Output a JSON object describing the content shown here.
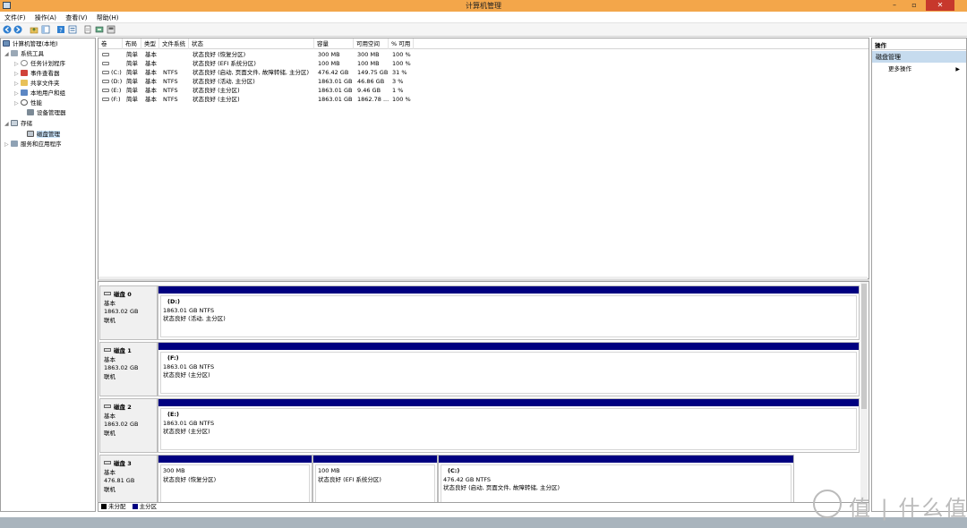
{
  "window": {
    "title": "计算机管理",
    "minimize": "–",
    "maximize": "▫",
    "close": "✕"
  },
  "menu": {
    "items": [
      "文件(F)",
      "操作(A)",
      "查看(V)",
      "帮助(H)"
    ]
  },
  "toolbar": {
    "icons": [
      "back-icon",
      "forward-icon",
      "folder-up-icon",
      "show-tree-icon",
      "help-icon",
      "properties-icon",
      "export-icon",
      "settings-icon"
    ]
  },
  "tree": {
    "items": [
      {
        "label": "计算机管理(本地)",
        "arrow": ""
      },
      {
        "label": "系统工具",
        "arrow": "◢"
      },
      {
        "label": "任务计划程序",
        "arrow": "▷"
      },
      {
        "label": "事件查看器",
        "arrow": "▷"
      },
      {
        "label": "共享文件夹",
        "arrow": "▷"
      },
      {
        "label": "本地用户和组",
        "arrow": "▷"
      },
      {
        "label": "性能",
        "arrow": "▷"
      },
      {
        "label": "设备管理器",
        "arrow": ""
      },
      {
        "label": "存储",
        "arrow": "◢"
      },
      {
        "label": "磁盘管理",
        "arrow": ""
      },
      {
        "label": "服务和应用程序",
        "arrow": "▷"
      }
    ]
  },
  "volumes": {
    "columns": [
      "卷",
      "布局",
      "类型",
      "文件系统",
      "状态",
      "容量",
      "可用空间",
      "% 可用"
    ],
    "rows": [
      [
        "",
        "简单",
        "基本",
        "",
        "状态良好 (恢复分区)",
        "300 MB",
        "300 MB",
        "100 %"
      ],
      [
        "",
        "简单",
        "基本",
        "",
        "状态良好 (EFI 系统分区)",
        "100 MB",
        "100 MB",
        "100 %"
      ],
      [
        "(C:)",
        "简单",
        "基本",
        "NTFS",
        "状态良好 (启动, 页面文件, 故障转储, 主分区)",
        "476.42 GB",
        "149.75 GB",
        "31 %"
      ],
      [
        "(D:)",
        "简单",
        "基本",
        "NTFS",
        "状态良好 (活动, 主分区)",
        "1863.01 GB",
        "46.86 GB",
        "3 %"
      ],
      [
        "(E:)",
        "简单",
        "基本",
        "NTFS",
        "状态良好 (主分区)",
        "1863.01 GB",
        "9.46 GB",
        "1 %"
      ],
      [
        "(F:)",
        "简单",
        "基本",
        "NTFS",
        "状态良好 (主分区)",
        "1863.01 GB",
        "1862.78 ...",
        "100 %"
      ]
    ]
  },
  "disks": [
    {
      "name": "磁盘 0",
      "type": "基本",
      "size": "1863.02 GB",
      "status": "联机",
      "partitions": [
        {
          "name": "(D:)",
          "size": "1863.01 GB NTFS",
          "status": "状态良好 (活动, 主分区)"
        }
      ]
    },
    {
      "name": "磁盘 1",
      "type": "基本",
      "size": "1863.02 GB",
      "status": "联机",
      "partitions": [
        {
          "name": "(F:)",
          "size": "1863.01 GB NTFS",
          "status": "状态良好 (主分区)"
        }
      ]
    },
    {
      "name": "磁盘 2",
      "type": "基本",
      "size": "1863.02 GB",
      "status": "联机",
      "partitions": [
        {
          "name": "(E:)",
          "size": "1863.01 GB NTFS",
          "status": "状态良好 (主分区)"
        }
      ]
    },
    {
      "name": "磁盘 3",
      "type": "基本",
      "size": "476.81 GB",
      "status": "联机",
      "partitions": [
        {
          "name": "",
          "size": "300 MB",
          "status": "状态良好 (恢复分区)"
        },
        {
          "name": "",
          "size": "100 MB",
          "status": "状态良好 (EFI 系统分区)"
        },
        {
          "name": "(C:)",
          "size": "476.42 GB NTFS",
          "status": "状态良好 (启动, 页面文件, 故障转储, 主分区)"
        }
      ]
    }
  ],
  "legend": {
    "unallocated": "未分配",
    "primary": "主分区",
    "unallocated_color": "#000000",
    "primary_color": "#000080"
  },
  "actions": {
    "header": "操作",
    "section": "磁盘管理",
    "more": "更多操作"
  },
  "watermark": {
    "text": "值 | 什么值得买"
  },
  "colors": {
    "titlebar": "#f3a64a",
    "partition_bar": "#000080",
    "selected": "#cde8ff",
    "action_section": "#c6dbee"
  }
}
